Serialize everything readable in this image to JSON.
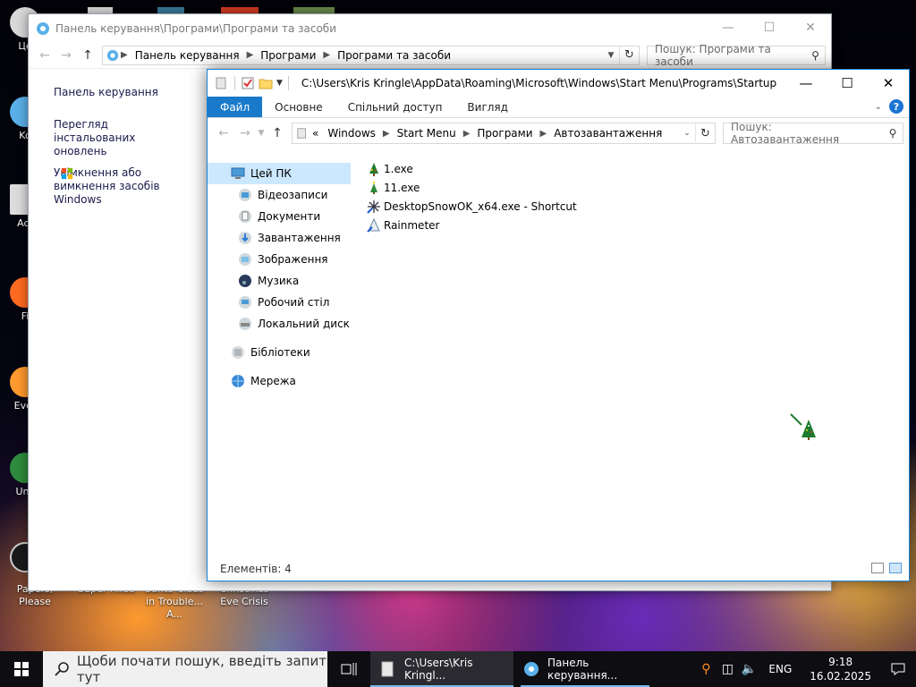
{
  "desktop": {
    "icons_left": [
      {
        "label": "Це",
        "color": "#d9d9d9"
      },
      {
        "label": "Ko",
        "color": "#5ab0e8"
      },
      {
        "label": "Act",
        "color": "#dcdcdc"
      },
      {
        "label": "Fi",
        "color": "#ff6a21"
      },
      {
        "label": "Ever",
        "color": "#ff9a2e"
      },
      {
        "label": "Unc",
        "color": "#2e8b3d"
      },
      {
        "label": "Papers, Please",
        "color": "#1a1a1a"
      }
    ],
    "bottom_captions": [
      "Super Hilda",
      "Santa Claus in Trouble... A...",
      "Christmas Eve Crisis"
    ]
  },
  "control_panel": {
    "title": "Панель керування\\Програми\\Програми та засоби",
    "breadcrumbs": [
      "Панель керування",
      "Програми",
      "Програми та засоби"
    ],
    "search_placeholder": "Пошук: Програми та засоби",
    "links": [
      "Панель керування",
      "Перегляд інстальованих оновлень",
      "Увімкнення або вимкнення засобів Windows"
    ]
  },
  "explorer": {
    "title": "C:\\Users\\Kris Kringle\\AppData\\Roaming\\Microsoft\\Windows\\Start Menu\\Programs\\Startup",
    "ribbon_tabs": [
      "Файл",
      "Основне",
      "Спільний доступ",
      "Вигляд"
    ],
    "breadcrumbs": [
      "Windows",
      "Start Menu",
      "Програми",
      "Автозавантаження"
    ],
    "breadcrumb_overflow": "«",
    "search_placeholder": "Пошук: Автозавантаження",
    "tree": [
      {
        "label": "Цей ПК",
        "level": 0,
        "selected": true,
        "icon": "pc-icon"
      },
      {
        "label": "Відеозаписи",
        "level": 1,
        "icon": "videos-icon"
      },
      {
        "label": "Документи",
        "level": 1,
        "icon": "documents-icon"
      },
      {
        "label": "Завантаження",
        "level": 1,
        "icon": "downloads-icon"
      },
      {
        "label": "Зображення",
        "level": 1,
        "icon": "pictures-icon"
      },
      {
        "label": "Музика",
        "level": 1,
        "icon": "music-icon"
      },
      {
        "label": "Робочий стіл",
        "level": 1,
        "icon": "desktop-icon"
      },
      {
        "label": "Локальний диск (C",
        "level": 1,
        "icon": "drive-icon"
      },
      {
        "label": "Бібліотеки",
        "level": 0,
        "icon": "libraries-icon"
      },
      {
        "label": "Мережа",
        "level": 0,
        "icon": "network-icon"
      }
    ],
    "files": [
      {
        "name": "1.exe",
        "icon": "xmas-tree-icon"
      },
      {
        "name": "11.exe",
        "icon": "xmas-tree-small-icon"
      },
      {
        "name": "DesktopSnowOK_x64.exe - Shortcut",
        "icon": "snowflake-icon"
      },
      {
        "name": "Rainmeter",
        "icon": "rainmeter-icon"
      }
    ],
    "status": "Елементів: 4"
  },
  "taskbar": {
    "search_placeholder": "Щоби почати пошук, введіть запит тут",
    "buttons": [
      {
        "label": "C:\\Users\\Kris Kringl...",
        "active": true
      },
      {
        "label": "Панель керування...",
        "active": false
      }
    ],
    "lang": "ENG",
    "time": "9:18",
    "date": "16.02.2025"
  },
  "colors": {
    "accent": "#1979ca",
    "selection": "#cce8ff",
    "taskbar": "#0e0e12"
  }
}
